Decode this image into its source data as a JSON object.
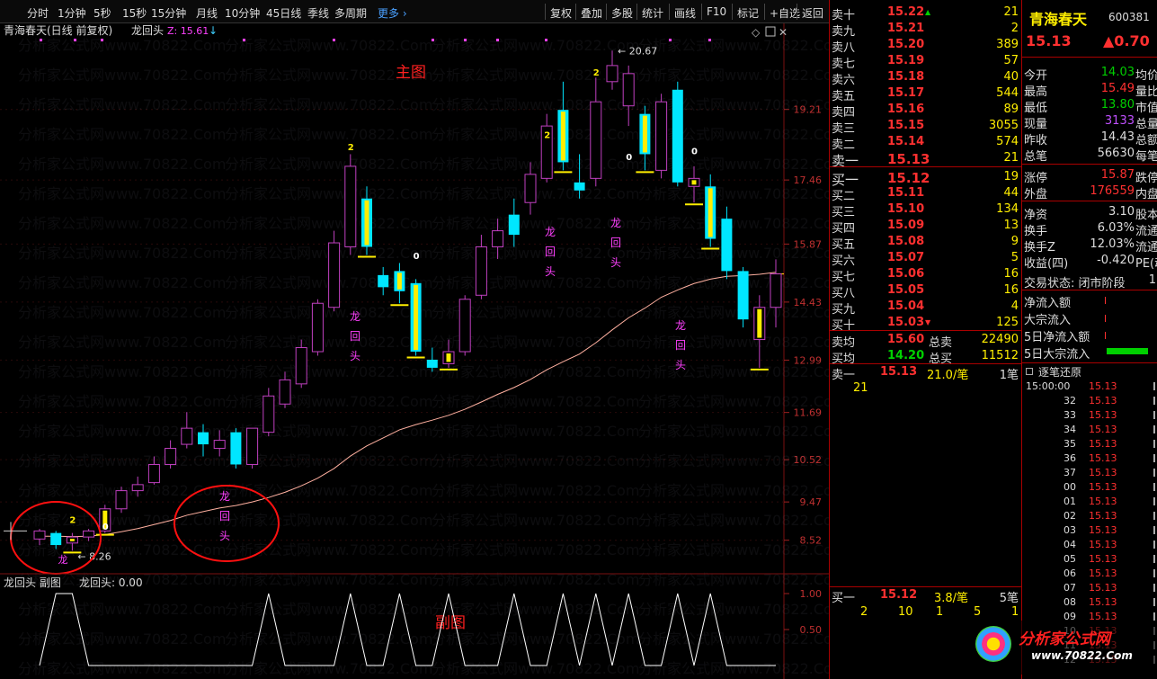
{
  "toolbar": {
    "left_tabs": [
      "分时",
      "1分钟",
      "5秒",
      "15秒",
      "15分钟",
      "月线",
      "10分钟",
      "45日线",
      "季线",
      "多周期"
    ],
    "more_label": "更多",
    "right_buttons": [
      "复权",
      "叠加",
      "多股",
      "统计",
      "画线",
      "F10",
      "标记",
      "+自选",
      "返回"
    ]
  },
  "chart_header": {
    "stock_name": "青海春天",
    "period": "(日线 前复权)",
    "indicator_name": "龙回头",
    "z_label": "Z: 15.61",
    "arrow": "↓"
  },
  "main_label": "主图",
  "sub_label": "副图",
  "sub_header": {
    "text": "龙回头 副图",
    "value_label": "龙回头: 0.00"
  },
  "price_axis": [
    "19.21",
    "17.46",
    "15.87",
    "14.43",
    "12.99",
    "11.69",
    "10.52",
    "9.47",
    "8.52"
  ],
  "sub_axis": [
    "1.00",
    "0.50"
  ],
  "annotations": {
    "high": "20.67",
    "low": "8.26",
    "dragon_text": [
      "龙",
      "回",
      "头"
    ]
  },
  "signal_numbers": [
    "2",
    "0",
    "2",
    "0",
    "2",
    "0",
    "2",
    "0"
  ],
  "watermark": "分析家公式网www.70822.Com",
  "quote": {
    "sells": [
      {
        "label": "卖十",
        "price": "15.22",
        "vol": "21",
        "mark": "▲"
      },
      {
        "label": "卖九",
        "price": "15.21",
        "vol": "2"
      },
      {
        "label": "卖八",
        "price": "15.20",
        "vol": "389"
      },
      {
        "label": "卖七",
        "price": "15.19",
        "vol": "57"
      },
      {
        "label": "卖六",
        "price": "15.18",
        "vol": "40"
      },
      {
        "label": "卖五",
        "price": "15.17",
        "vol": "544"
      },
      {
        "label": "卖四",
        "price": "15.16",
        "vol": "89"
      },
      {
        "label": "卖三",
        "price": "15.15",
        "vol": "3055"
      },
      {
        "label": "卖二",
        "price": "15.14",
        "vol": "574"
      },
      {
        "label": "卖一",
        "price": "15.13",
        "vol": "21"
      }
    ],
    "buys": [
      {
        "label": "买一",
        "price": "15.12",
        "vol": "19"
      },
      {
        "label": "买二",
        "price": "15.11",
        "vol": "44"
      },
      {
        "label": "买三",
        "price": "15.10",
        "vol": "134"
      },
      {
        "label": "买四",
        "price": "15.09",
        "vol": "13"
      },
      {
        "label": "买五",
        "price": "15.08",
        "vol": "9"
      },
      {
        "label": "买六",
        "price": "15.07",
        "vol": "5"
      },
      {
        "label": "买七",
        "price": "15.06",
        "vol": "16"
      },
      {
        "label": "买八",
        "price": "15.05",
        "vol": "16"
      },
      {
        "label": "买九",
        "price": "15.04",
        "vol": "4"
      },
      {
        "label": "买十",
        "price": "15.03",
        "vol": "125",
        "mark": "▼"
      }
    ],
    "avg_sell": {
      "label": "卖均",
      "price": "15.60",
      "tlabel": "总卖",
      "tval": "22490"
    },
    "avg_buy": {
      "label": "买均",
      "price": "14.20",
      "tlabel": "总买",
      "tval": "11512"
    },
    "trade_top": {
      "label": "卖一",
      "price": "15.13",
      "vol": "21.0/笔",
      "count": "1笔",
      "sub": "21"
    },
    "trade_bottom": {
      "label": "买一",
      "price": "15.12",
      "vol": "3.8/笔",
      "count": "5笔",
      "subs": [
        "2",
        "10",
        "1",
        "5",
        "1"
      ]
    }
  },
  "info": {
    "name": "青海春天",
    "code": "600381",
    "price": "15.13",
    "change": "▲0.70",
    "rows": [
      {
        "k": "今开",
        "v": "14.03",
        "k2": "均价",
        "c": "#00d000"
      },
      {
        "k": "最高",
        "v": "15.49",
        "k2": "量比",
        "c": "#ff3030"
      },
      {
        "k": "最低",
        "v": "13.80",
        "k2": "市值",
        "c": "#00d000"
      },
      {
        "k": "现量",
        "v": "3133",
        "k2": "总量",
        "c": "#c050ff"
      },
      {
        "k": "昨收",
        "v": "14.43",
        "k2": "总额",
        "c": "#ddd"
      },
      {
        "k": "总笔",
        "v": "56630",
        "k2": "每笔",
        "c": "#ddd"
      },
      {
        "k": "涨停",
        "v": "15.87",
        "k2": "跌停",
        "c": "#ff3030"
      },
      {
        "k": "外盘",
        "v": "176559",
        "k2": "内盘",
        "c": "#ff3030"
      },
      {
        "k": "净资",
        "v": "3.10",
        "k2": "股本",
        "c": "#ddd"
      },
      {
        "k": "换手",
        "v": "6.03%",
        "k2": "流通",
        "c": "#ddd"
      },
      {
        "k": "换手Z",
        "v": "12.03%",
        "k2": "流通",
        "c": "#ddd"
      },
      {
        "k": "收益(四)",
        "v": "-0.420",
        "k2": "PE(动)",
        "c": "#ddd"
      }
    ],
    "status": "交易状态: 闭市阶段",
    "status_tail": "1",
    "flows": [
      "净流入额",
      "大宗流入",
      "5日净流入额",
      "5日大宗流入"
    ],
    "tick_title": "逐笔还原",
    "ticks": [
      {
        "t": "15:00:00",
        "p": "15.13"
      },
      {
        "t": "32",
        "p": "15.13"
      },
      {
        "t": "33",
        "p": "15.13"
      },
      {
        "t": "34",
        "p": "15.13"
      },
      {
        "t": "35",
        "p": "15.13"
      },
      {
        "t": "36",
        "p": "15.13"
      },
      {
        "t": "37",
        "p": "15.13"
      },
      {
        "t": "00",
        "p": "15.13"
      },
      {
        "t": "01",
        "p": "15.13"
      },
      {
        "t": "02",
        "p": "15.13"
      },
      {
        "t": "03",
        "p": "15.13"
      },
      {
        "t": "04",
        "p": "15.13"
      },
      {
        "t": "05",
        "p": "15.13"
      },
      {
        "t": "06",
        "p": "15.13"
      },
      {
        "t": "07",
        "p": "15.13"
      },
      {
        "t": "08",
        "p": "15.13"
      },
      {
        "t": "09",
        "p": "15.13"
      },
      {
        "t": "10",
        "p": "15.13"
      },
      {
        "t": "11",
        "p": "15.13"
      },
      {
        "t": "12",
        "p": "15.13"
      }
    ],
    "logo": "分析家公式网",
    "logo_url": "www.70822.Com"
  },
  "chart_data": {
    "type": "candlestick",
    "title": "青海春天",
    "ylabel": "",
    "ylim": [
      8.0,
      20.9
    ],
    "candles": [
      [
        8.55,
        8.75,
        8.4,
        8.8
      ],
      [
        8.7,
        8.4,
        8.3,
        8.75
      ],
      [
        8.45,
        8.6,
        8.26,
        8.7
      ],
      [
        8.6,
        8.75,
        8.5,
        8.8
      ],
      [
        8.75,
        9.3,
        8.7,
        9.4
      ],
      [
        9.3,
        9.75,
        9.2,
        9.85
      ],
      [
        9.75,
        9.9,
        9.6,
        10.1
      ],
      [
        9.95,
        10.4,
        9.9,
        10.6
      ],
      [
        10.4,
        10.8,
        10.3,
        11.0
      ],
      [
        10.9,
        11.3,
        10.8,
        11.7
      ],
      [
        11.2,
        10.9,
        10.6,
        11.4
      ],
      [
        10.8,
        11.0,
        10.6,
        11.25
      ],
      [
        11.2,
        10.4,
        10.3,
        11.3
      ],
      [
        10.4,
        11.3,
        10.3,
        11.3
      ],
      [
        11.2,
        12.1,
        11.1,
        12.3
      ],
      [
        11.9,
        12.5,
        11.8,
        12.7
      ],
      [
        12.4,
        13.3,
        12.3,
        13.5
      ],
      [
        13.2,
        14.4,
        13.1,
        14.5
      ],
      [
        14.3,
        15.9,
        14.2,
        16.2
      ],
      [
        15.8,
        17.8,
        15.6,
        18.1
      ],
      [
        17.0,
        15.8,
        15.6,
        17.3
      ],
      [
        15.1,
        14.8,
        14.6,
        15.3
      ],
      [
        15.2,
        14.7,
        14.4,
        15.4
      ],
      [
        14.9,
        13.2,
        13.1,
        15.0
      ],
      [
        13.0,
        12.8,
        12.7,
        13.3
      ],
      [
        12.9,
        13.2,
        12.8,
        13.5
      ],
      [
        13.2,
        14.5,
        13.1,
        14.6
      ],
      [
        14.6,
        15.8,
        14.5,
        16.1
      ],
      [
        15.8,
        16.2,
        15.5,
        16.5
      ],
      [
        16.6,
        16.1,
        15.8,
        17.0
      ],
      [
        16.9,
        17.6,
        16.6,
        17.9
      ],
      [
        17.5,
        18.8,
        17.4,
        19.1
      ],
      [
        19.2,
        17.9,
        17.7,
        19.9
      ],
      [
        17.4,
        17.2,
        17.0,
        18.1
      ],
      [
        17.5,
        19.4,
        17.3,
        20.0
      ],
      [
        19.9,
        20.3,
        19.7,
        20.67
      ],
      [
        19.3,
        20.1,
        18.8,
        20.3
      ],
      [
        19.1,
        18.1,
        17.7,
        19.3
      ],
      [
        17.7,
        19.4,
        17.5,
        19.6
      ],
      [
        19.7,
        17.4,
        17.3,
        19.9
      ],
      [
        17.3,
        17.5,
        16.9,
        17.8
      ],
      [
        17.3,
        16.0,
        15.8,
        17.6
      ],
      [
        16.5,
        15.2,
        15.0,
        16.8
      ],
      [
        15.2,
        14.0,
        13.8,
        15.3
      ],
      [
        13.5,
        14.3,
        12.8,
        14.6
      ],
      [
        14.3,
        15.13,
        13.8,
        15.49
      ]
    ],
    "ma": [
      8.62,
      8.62,
      8.61,
      8.62,
      8.66,
      8.73,
      8.81,
      8.91,
      9.01,
      9.14,
      9.23,
      9.32,
      9.38,
      9.47,
      9.58,
      9.71,
      9.87,
      10.06,
      10.3,
      10.61,
      10.86,
      11.06,
      11.26,
      11.39,
      11.5,
      11.62,
      11.77,
      11.95,
      12.14,
      12.31,
      12.51,
      12.75,
      12.95,
      13.14,
      13.42,
      13.74,
      14.04,
      14.28,
      14.55,
      14.73,
      14.89,
      15.0,
      15.07,
      15.09,
      15.12,
      15.17
    ],
    "signal_bars": [
      2,
      4,
      20,
      22,
      23,
      25,
      32,
      37,
      40,
      41,
      44
    ],
    "sub_series": [
      0,
      1,
      1,
      0,
      0,
      0,
      0,
      0,
      0,
      0,
      0,
      0,
      0,
      0,
      1,
      0,
      0,
      0,
      0,
      1,
      0,
      0,
      1,
      0,
      0,
      1,
      0,
      0,
      0,
      1,
      0,
      0,
      1,
      0,
      1,
      0,
      1,
      0,
      0,
      1,
      0,
      1,
      0,
      0,
      0,
      0
    ]
  }
}
